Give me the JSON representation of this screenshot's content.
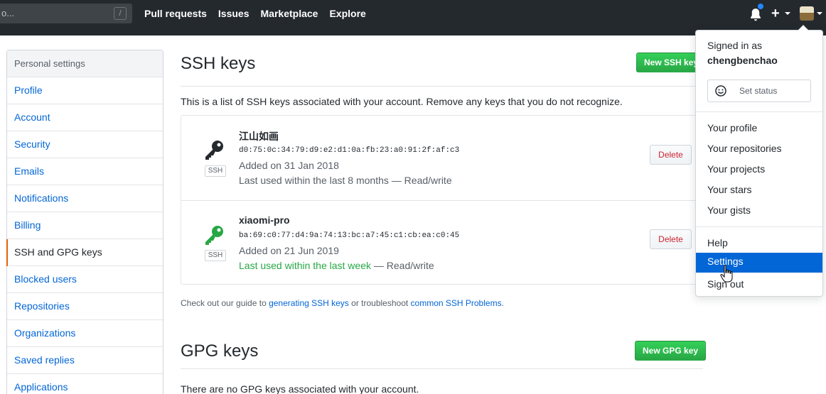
{
  "header": {
    "search_placeholder": "o...",
    "search_shortcut": "/",
    "nav": [
      "Pull requests",
      "Issues",
      "Marketplace",
      "Explore"
    ],
    "notification_dot_color": "#2188ff",
    "plus_label": "+"
  },
  "sidebar": {
    "heading": "Personal settings",
    "items": [
      {
        "label": "Profile"
      },
      {
        "label": "Account"
      },
      {
        "label": "Security"
      },
      {
        "label": "Emails"
      },
      {
        "label": "Notifications"
      },
      {
        "label": "Billing"
      },
      {
        "label": "SSH and GPG keys",
        "selected": true
      },
      {
        "label": "Blocked users"
      },
      {
        "label": "Repositories"
      },
      {
        "label": "Organizations"
      },
      {
        "label": "Saved replies"
      },
      {
        "label": "Applications"
      }
    ]
  },
  "ssh": {
    "title": "SSH keys",
    "new_button": "New SSH key",
    "description": "This is a list of SSH keys associated with your account. Remove any keys that you do not recognize.",
    "keys": [
      {
        "name": "江山如画",
        "fingerprint": "d0:75:0c:34:79:d9:e2:d1:0a:fb:23:a0:91:2f:af:c3",
        "added": "Added on 31 Jan 2018",
        "used_prefix": "Last used within the last 8 months",
        "used_suffix": " — Read/write",
        "recent": false,
        "badge": "SSH",
        "delete_label": "Delete",
        "icon_color": "#24292e"
      },
      {
        "name": "xiaomi-pro",
        "fingerprint": "ba:69:c0:77:d4:9a:74:13:bc:a7:45:c1:cb:ea:c0:45",
        "added": "Added on 21 Jun 2019",
        "used_prefix": "Last used within the last week",
        "used_suffix": " — Read/write",
        "recent": true,
        "badge": "SSH",
        "delete_label": "Delete",
        "icon_color": "#28a745"
      }
    ],
    "guide": {
      "pre": "Check out our guide to ",
      "link1": "generating SSH keys",
      "mid": " or troubleshoot ",
      "link2": "common SSH Problems",
      "post": "."
    }
  },
  "gpg": {
    "title": "GPG keys",
    "new_button": "New GPG key",
    "description": "There are no GPG keys associated with your account."
  },
  "dropdown": {
    "signed_in_as": "Signed in as",
    "username": "chengbenchao",
    "set_status": "Set status",
    "group1": [
      "Your profile",
      "Your repositories",
      "Your projects",
      "Your stars",
      "Your gists"
    ],
    "group2": [
      "Help",
      "Settings",
      "Sign out"
    ],
    "active_item": "Settings"
  },
  "colors": {
    "header_bg": "#24292e",
    "link": "#0366d6",
    "green": "#28a745",
    "danger": "#cb2431",
    "selected_accent": "#e36209"
  }
}
